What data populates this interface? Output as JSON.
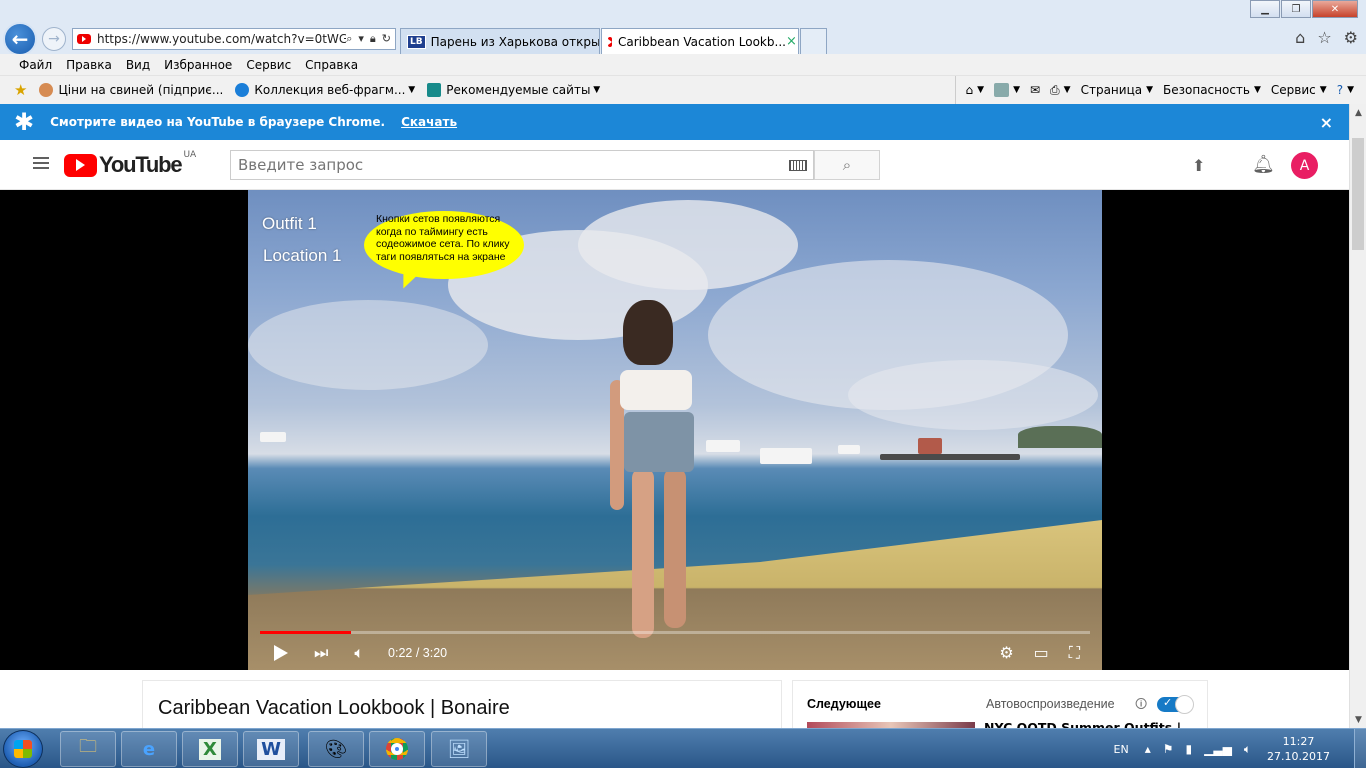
{
  "browser": {
    "url": "https://www.youtube.com/watch?v=0tWG(",
    "tabs": [
      {
        "label": "Парень из Харькова открыл ...",
        "favicon": "LB"
      },
      {
        "label": "Caribbean Vacation Lookb...",
        "close": "×"
      }
    ],
    "menu": [
      "Файл",
      "Правка",
      "Вид",
      "Избранное",
      "Сервис",
      "Справка"
    ],
    "favorites": [
      {
        "label": "Ціни на свиней (підприє..."
      },
      {
        "label": "Коллекция веб-фрагм..."
      },
      {
        "label": "Рекомендуемые сайты"
      }
    ],
    "commands": [
      "Страница",
      "Безопасность",
      "Сервис"
    ]
  },
  "banner": {
    "text": "Смотрите видео на YouTube в браузере Chrome.",
    "link": "Скачать",
    "close": "×"
  },
  "youtube": {
    "logo_text": "YouTube",
    "country": "UA",
    "search_placeholder": "Введите запрос",
    "avatar_letter": "A",
    "video_title": "Caribbean Vacation Lookbook | Bonaire",
    "overlay": {
      "outfit": "Outfit 1",
      "location": "Location 1",
      "note": "Кнопки сетов появляются когда по таймингу есть содеожимое сета. По клику таги появляться на экране"
    },
    "player": {
      "time": "0:22 / 3:20",
      "progress_fraction": 0.11
    },
    "sidebar": {
      "next_label": "Следующее",
      "autoplay_label": "Автовоспроизведение",
      "autoplay_on": true,
      "next_title": "NYC OOTD Summer Outfits |"
    }
  },
  "taskbar": {
    "lang": "EN",
    "time": "11:27",
    "date": "27.10.2017"
  },
  "colors": {
    "youtube_red": "#ff0000",
    "banner_blue": "#1c87d7",
    "avatar_pink": "#e91e63",
    "bubble_yellow": "#ffff00"
  }
}
